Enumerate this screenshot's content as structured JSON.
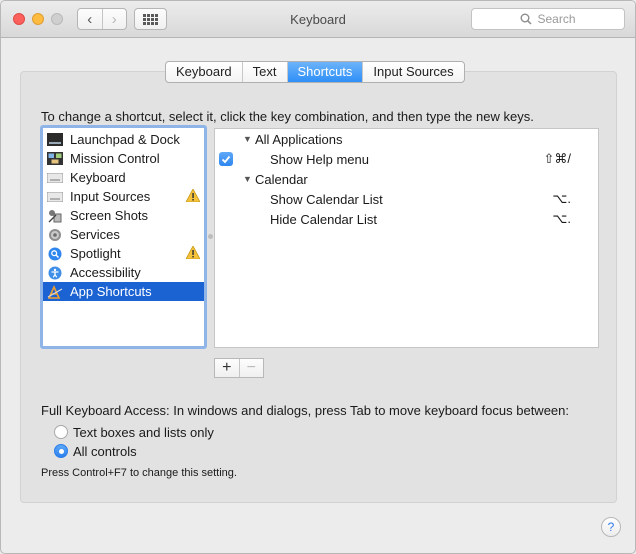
{
  "window": {
    "title": "Keyboard"
  },
  "toolbar": {
    "search_placeholder": "Search",
    "back_glyph": "‹",
    "forward_glyph": "›"
  },
  "tabs": [
    {
      "label": "Keyboard",
      "active": false
    },
    {
      "label": "Text",
      "active": false
    },
    {
      "label": "Shortcuts",
      "active": true
    },
    {
      "label": "Input Sources",
      "active": false
    }
  ],
  "instructions": "To change a shortcut, select it, click the key combination, and then type the new keys.",
  "categories": [
    {
      "label": "Launchpad & Dock",
      "icon": "launchpad-dock-icon",
      "warning": false,
      "selected": false
    },
    {
      "label": "Mission Control",
      "icon": "mission-control-icon",
      "warning": false,
      "selected": false
    },
    {
      "label": "Keyboard",
      "icon": "keyboard-icon",
      "warning": false,
      "selected": false
    },
    {
      "label": "Input Sources",
      "icon": "input-sources-icon",
      "warning": true,
      "selected": false
    },
    {
      "label": "Screen Shots",
      "icon": "screen-shots-icon",
      "warning": false,
      "selected": false
    },
    {
      "label": "Services",
      "icon": "services-gear-icon",
      "warning": false,
      "selected": false
    },
    {
      "label": "Spotlight",
      "icon": "spotlight-icon",
      "warning": true,
      "selected": false
    },
    {
      "label": "Accessibility",
      "icon": "accessibility-icon",
      "warning": false,
      "selected": false
    },
    {
      "label": "App Shortcuts",
      "icon": "app-shortcuts-icon",
      "warning": false,
      "selected": true
    }
  ],
  "shortcuts": [
    {
      "kind": "group",
      "label": "All Applications",
      "key": ""
    },
    {
      "kind": "item",
      "label": "Show Help menu",
      "key": "⇧⌘/",
      "checked": true
    },
    {
      "kind": "group",
      "label": "Calendar",
      "key": ""
    },
    {
      "kind": "item",
      "label": "Show Calendar List",
      "key": "⌥.",
      "checked": false
    },
    {
      "kind": "item",
      "label": "Hide Calendar List",
      "key": "⌥.",
      "checked": false
    }
  ],
  "buttons": {
    "add": "+",
    "remove": "−",
    "help": "?"
  },
  "keyboard_access": {
    "label": "Full Keyboard Access: In windows and dialogs, press Tab to move keyboard focus between:",
    "options": [
      {
        "label": "Text boxes and lists only",
        "selected": false
      },
      {
        "label": "All controls",
        "selected": true
      }
    ],
    "hint": "Press Control+F7 to change this setting."
  },
  "colors": {
    "accent": "#2f8ff7",
    "selection": "#1b62d3",
    "warning": "#f5c33b"
  }
}
